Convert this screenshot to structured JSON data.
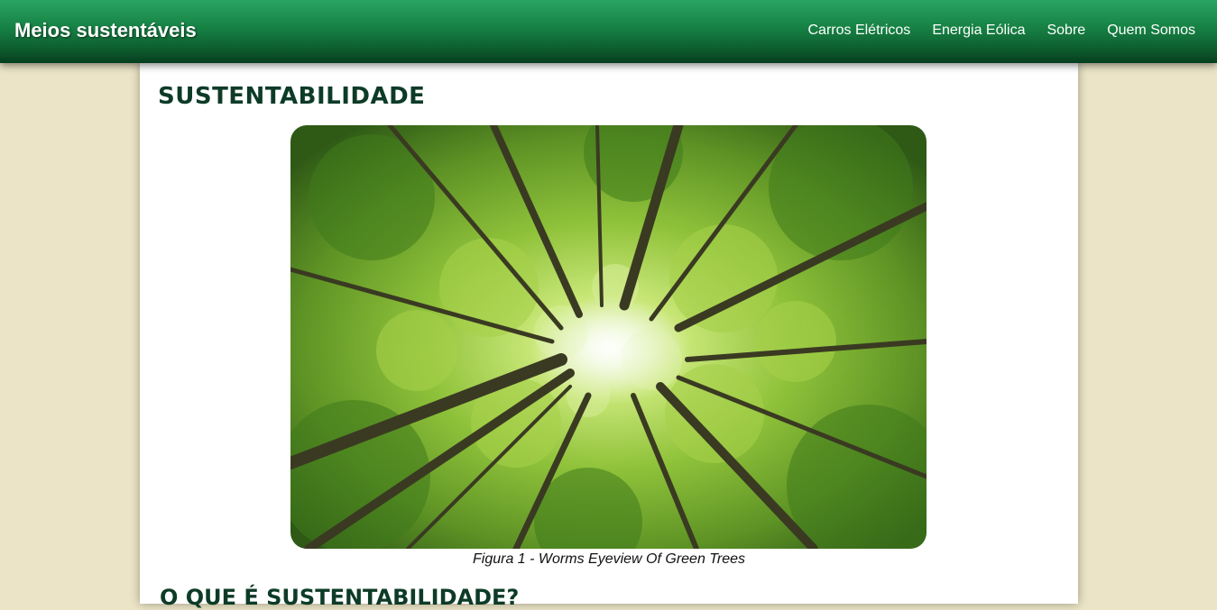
{
  "header": {
    "brand": "Meios sustentáveis",
    "nav": [
      {
        "label": "Carros Elétricos"
      },
      {
        "label": "Energia Eólica"
      },
      {
        "label": "Sobre"
      },
      {
        "label": "Quem Somos"
      }
    ]
  },
  "main": {
    "title": "SUSTENTABILIDADE",
    "figure": {
      "caption": "Figura 1 - Worms Eyeview Of Green Trees"
    },
    "section_title": "O QUE É SUSTENTABILIDADE?"
  },
  "colors": {
    "header_top": "#2aa563",
    "header_bottom": "#063e1f",
    "page_background": "#ebe4c6",
    "heading": "#0d3b27"
  }
}
